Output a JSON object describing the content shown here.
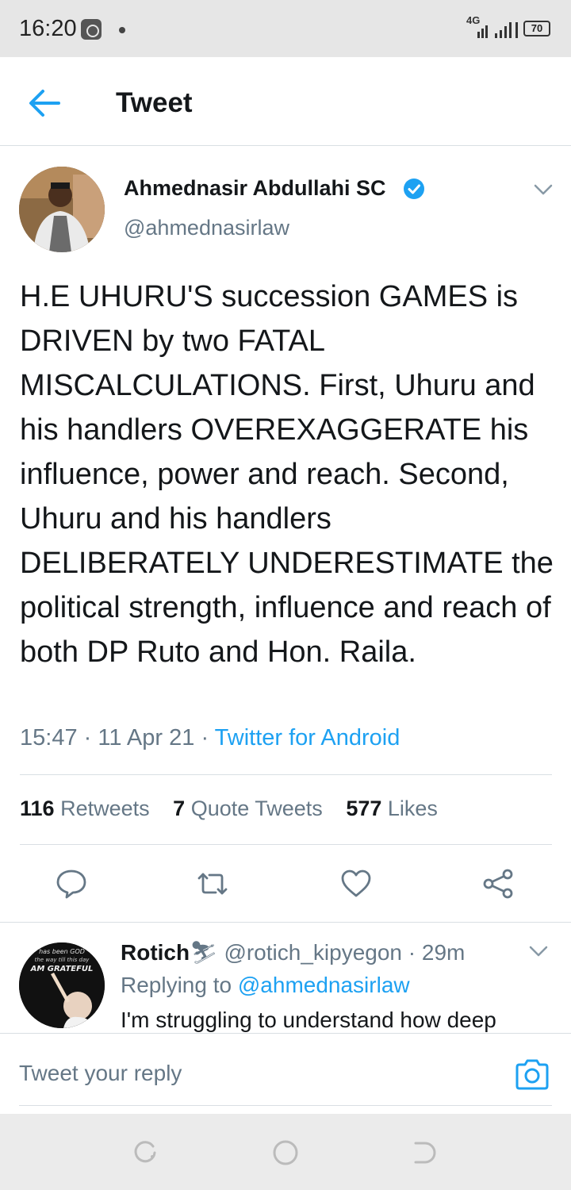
{
  "status_bar": {
    "time": "16:20",
    "network": "4G",
    "battery": "70"
  },
  "header": {
    "title": "Tweet"
  },
  "tweet": {
    "author_name": "Ahmednasir Abdullahi SC",
    "author_handle": "@ahmednasirlaw",
    "text": "H.E UHURU'S succession GAMES is DRIVEN by two FATAL MISCALCULATIONS. First, Uhuru and his handlers OVEREXAGGERATE his influence, power and reach. Second, Uhuru and his handlers DELIBERATELY UNDERESTIMATE the political strength, influence and reach of both DP Ruto and Hon. Raila.",
    "time": "15:47",
    "date": "11 Apr 21",
    "source": "Twitter for Android",
    "stats": {
      "retweets_count": "116",
      "retweets_label": "Retweets",
      "quote_count": "7",
      "quote_label": "Quote Tweets",
      "likes_count": "577",
      "likes_label": "Likes"
    }
  },
  "reply": {
    "name": "Rotich",
    "name_emoji": "⛷",
    "handle": "@rotich_kipyegon",
    "age": "29m",
    "replying_prefix": "Replying to",
    "replying_to": "@ahmednasirlaw",
    "text": "I'm struggling to understand how deep",
    "avatar_caption_top": "has been GOD",
    "avatar_caption_mid": "the way till this day",
    "avatar_caption_bottom": "AM GRATEFUL"
  },
  "composer": {
    "placeholder": "Tweet your reply"
  },
  "colors": {
    "accent": "#1da1f2",
    "secondary_text": "#657786",
    "primary_text": "#14171a"
  }
}
